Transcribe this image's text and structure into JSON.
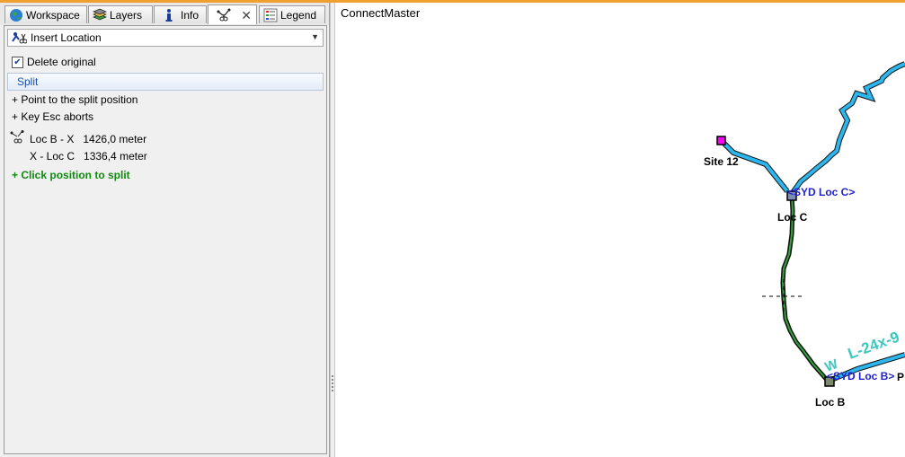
{
  "tabs": [
    {
      "label": "Workspace",
      "icon": "globe-icon"
    },
    {
      "label": "Layers",
      "icon": "layers-icon"
    },
    {
      "label": "Info",
      "icon": "info-icon"
    },
    {
      "label": "",
      "icon": "split-tool-icon"
    },
    {
      "label": "Legend",
      "icon": "legend-icon"
    }
  ],
  "tool_combo": {
    "value": "Insert Location"
  },
  "delete_original": {
    "label": "Delete original",
    "checked": true
  },
  "section": {
    "title": "Split"
  },
  "instructions": [
    "+ Point to the split position",
    "+ Key Esc aborts"
  ],
  "measures": [
    {
      "label": "Loc B - X",
      "value": "1426,0 meter"
    },
    {
      "label": "X - Loc C",
      "value": "1336,4 meter"
    }
  ],
  "action_prompt": "+ Click position to split",
  "map": {
    "title": "ConnectMaster",
    "labels": {
      "site12": "Site 12",
      "locC": "Loc C",
      "locB": "Loc B",
      "sydLocC": "<SYD Loc C>",
      "sydLocB": "<SYD Loc B>",
      "cable": "L-24x-9",
      "partial1": "W",
      "partial2": "P"
    },
    "colors": {
      "duct": "#2bb6ee",
      "cable_sel": "#0a7a12",
      "label_blue": "#2222cc",
      "cable_label": "#3cc8c0",
      "site": "#ff00ff"
    }
  }
}
